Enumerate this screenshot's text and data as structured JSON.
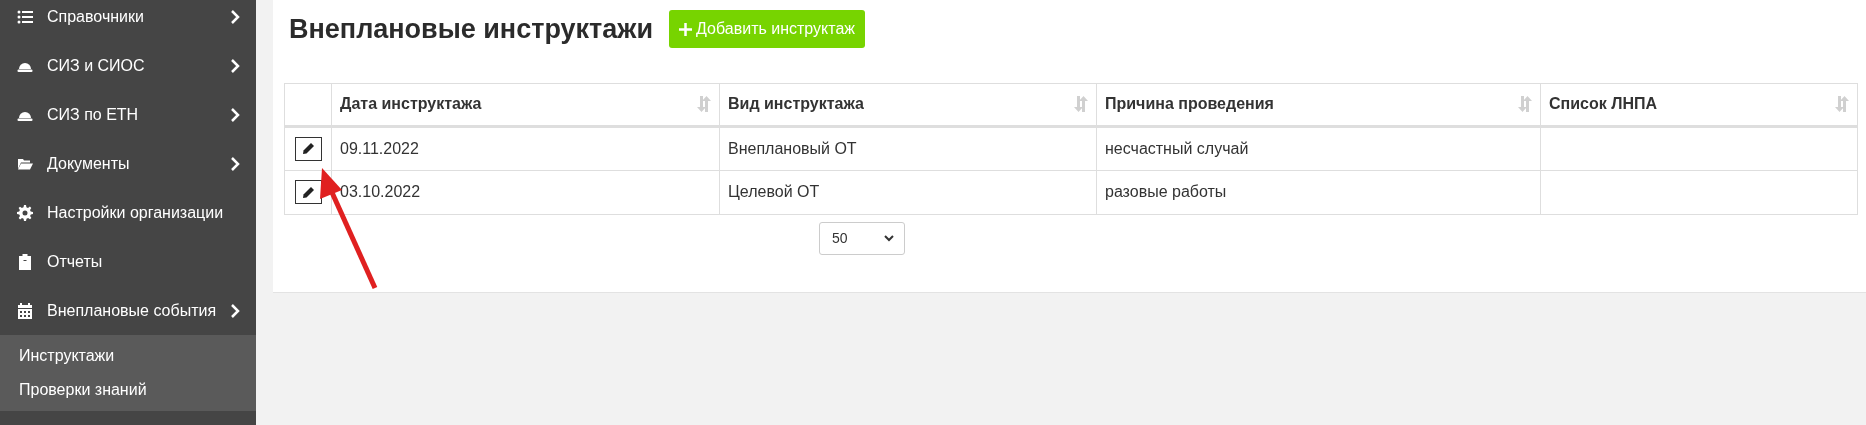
{
  "sidebar": {
    "items": [
      {
        "label": "Справочники",
        "has_submenu": true
      },
      {
        "label": "СИЗ и СИОС",
        "has_submenu": true
      },
      {
        "label": "СИЗ по ЕТН",
        "has_submenu": true
      },
      {
        "label": "Документы",
        "has_submenu": true
      },
      {
        "label": "Настройки организации",
        "has_submenu": false
      },
      {
        "label": "Отчеты",
        "has_submenu": false
      },
      {
        "label": "Внеплановые события",
        "has_submenu": true,
        "children": [
          {
            "label": "Инструктажи"
          },
          {
            "label": "Проверки знаний"
          }
        ]
      }
    ]
  },
  "page": {
    "title": "Внеплановые инструктажи",
    "add_button": "Добавить инструктаж"
  },
  "table": {
    "columns": [
      {
        "label": "Дата инструктажа",
        "sortable": true
      },
      {
        "label": "Вид инструктажа",
        "sortable": true
      },
      {
        "label": "Причина проведения",
        "sortable": true
      },
      {
        "label": "Список ЛНПА",
        "sortable": true
      }
    ],
    "rows": [
      {
        "cells": [
          "09.11.2022",
          "Внеплановый ОТ",
          "несчастный случай",
          ""
        ]
      },
      {
        "cells": [
          "03.10.2022",
          "Целевой ОТ",
          "разовые работы",
          ""
        ]
      }
    ]
  },
  "page_size": {
    "value": "50"
  }
}
